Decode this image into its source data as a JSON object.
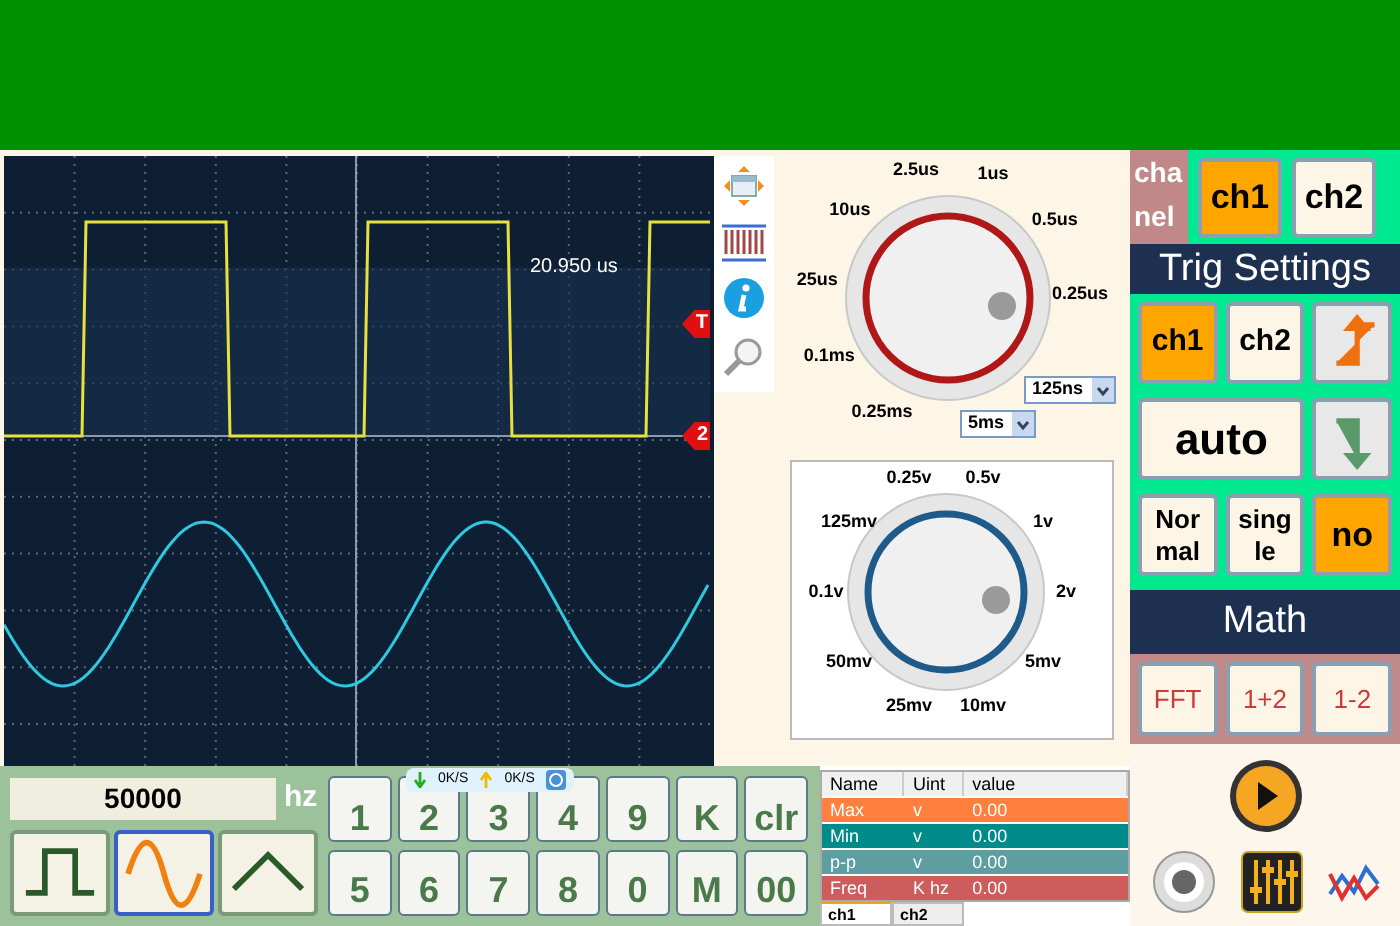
{
  "scope": {
    "measurement": "20.950 us",
    "markers": [
      {
        "label": "T"
      },
      {
        "label": "2"
      }
    ]
  },
  "timebase": {
    "labels": [
      "2.5us",
      "1us",
      "10us",
      "0.5us",
      "25us",
      "0.25us",
      "0.1ms",
      "0.25ms"
    ],
    "selects": [
      "125ns",
      "5ms"
    ]
  },
  "volts": {
    "labels": [
      "0.25v",
      "0.5v",
      "125mv",
      "1v",
      "0.1v",
      "2v",
      "50mv",
      "5mv",
      "25mv",
      "10mv"
    ]
  },
  "channel": {
    "label_lines": [
      "cha",
      "nel"
    ],
    "buttons": [
      {
        "label": "ch1",
        "selected": true
      },
      {
        "label": "ch2",
        "selected": false
      }
    ]
  },
  "trig": {
    "title": "Trig Settings",
    "sources": [
      {
        "label": "ch1",
        "selected": true
      },
      {
        "label": "ch2",
        "selected": false
      }
    ],
    "edges": [
      {
        "kind": "rising"
      },
      {
        "kind": "falling"
      }
    ],
    "mode": "auto",
    "options": [
      {
        "label": "Nor mal",
        "selected": false
      },
      {
        "label": "sing le",
        "selected": false
      },
      {
        "label": "no",
        "selected": true
      }
    ]
  },
  "math": {
    "title": "Math",
    "buttons": [
      "FFT",
      "1+2",
      "1-2"
    ]
  },
  "generator": {
    "frequency": "50000",
    "unit": "hz",
    "waveforms": [
      {
        "kind": "square",
        "selected": false
      },
      {
        "kind": "sine",
        "selected": true
      },
      {
        "kind": "triangle",
        "selected": false
      }
    ],
    "keys": [
      "1",
      "2",
      "3",
      "4",
      "9",
      "K",
      "clr",
      "5",
      "6",
      "7",
      "8",
      "0",
      "M",
      "00"
    ]
  },
  "net_overlay": {
    "down": "0K/S",
    "up": "0K/S"
  },
  "measurements": {
    "columns": [
      "Name",
      "Uint",
      "value"
    ],
    "rows": [
      {
        "cells": [
          "Max",
          "v",
          "0.00"
        ],
        "color": "#ff7f3f"
      },
      {
        "cells": [
          "Min",
          "v",
          "0.00"
        ],
        "color": "#008b8b"
      },
      {
        "cells": [
          "p-p",
          "v",
          "0.00"
        ],
        "color": "#5f9ea0"
      },
      {
        "cells": [
          "Freq",
          "K hz",
          "0.00"
        ],
        "color": "#cd5c5c"
      }
    ],
    "tabs": [
      {
        "label": "ch1",
        "selected": true
      },
      {
        "label": "ch2",
        "selected": false
      }
    ]
  }
}
